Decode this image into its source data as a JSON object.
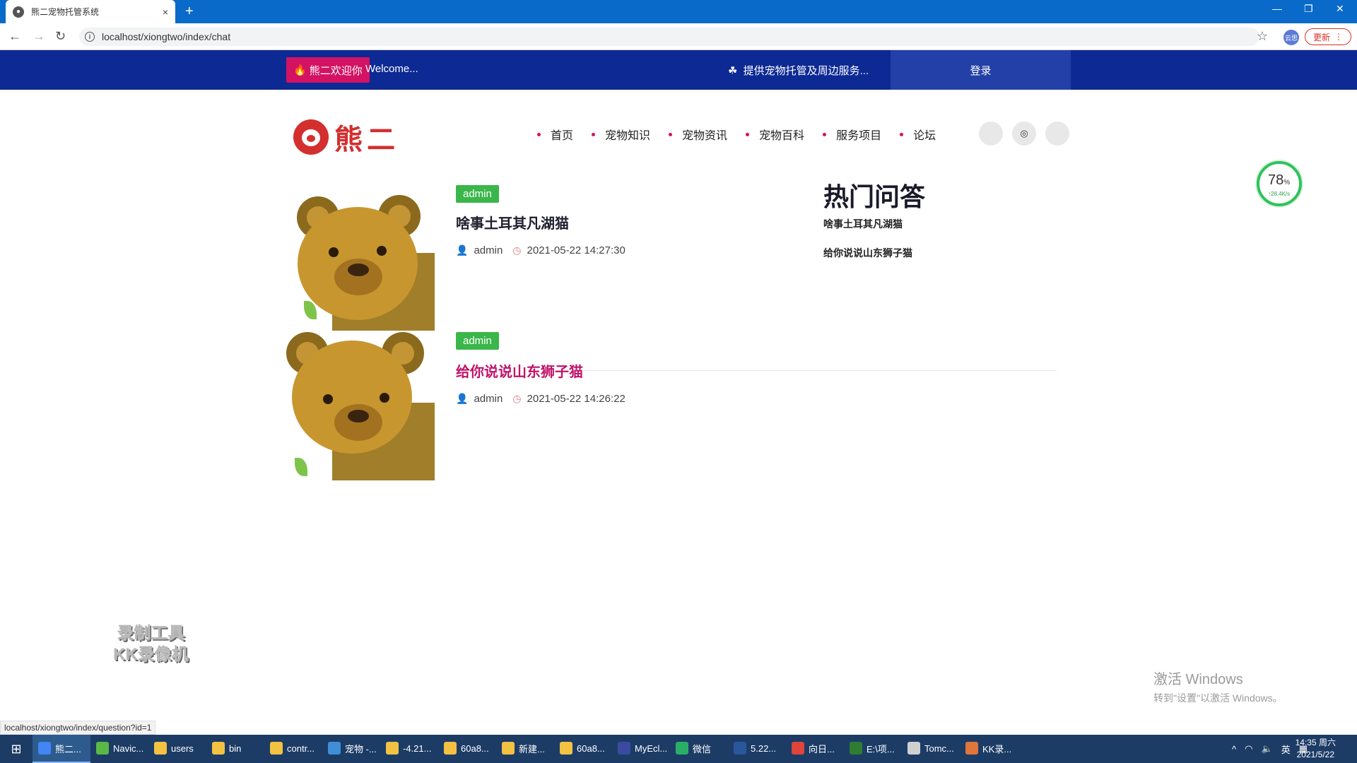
{
  "browser": {
    "tab_title": "熊二宠物托管系统",
    "tab_close": "×",
    "new_tab": "+",
    "url": "localhost/xiongtwo/index/chat",
    "profile": "云思",
    "update_label": "更新",
    "status_url": "localhost/xiongtwo/index/question?id=1"
  },
  "topbar": {
    "welcome_badge": "熊二欢迎你",
    "welcome_text": "Welcome...",
    "service_text": "提供宠物托管及周边服务...",
    "login_label": "登录"
  },
  "logo": {
    "text": "熊二"
  },
  "nav": {
    "items": [
      "首页",
      "宠物知识",
      "宠物资讯",
      "宠物百科",
      "服务项目",
      "论坛"
    ]
  },
  "posts": [
    {
      "tag": "admin",
      "title": "啥事土耳其凡湖猫",
      "author": "admin",
      "time": "2021-05-22 14:27:30"
    },
    {
      "tag": "admin",
      "title": "给你说说山东狮子猫",
      "author": "admin",
      "time": "2021-05-22 14:26:22"
    }
  ],
  "sidebar": {
    "title": "热门问答",
    "links": [
      "啥事土耳其凡湖猫",
      "给你说说山东狮子猫"
    ]
  },
  "speed_widget": {
    "percent": "78",
    "unit": "%",
    "rate": "↑28.4K/s"
  },
  "watermark": {
    "line1": "录制工具",
    "line2": "KK录像机"
  },
  "activate": {
    "line1": "激活 Windows",
    "line2": "转到\"设置\"以激活 Windows。"
  },
  "taskbar": {
    "items": [
      {
        "label": "熊二...",
        "color": "#4285f4"
      },
      {
        "label": "Navic...",
        "color": "#5ab946"
      },
      {
        "label": "users",
        "color": "#f3c242"
      },
      {
        "label": "bin",
        "color": "#f3c242"
      },
      {
        "label": "contr...",
        "color": "#f3c242"
      },
      {
        "label": "宠物 -...",
        "color": "#3e8ed8"
      },
      {
        "label": "-4.21...",
        "color": "#f3c242"
      },
      {
        "label": "60a8...",
        "color": "#f3c242"
      },
      {
        "label": "新建...",
        "color": "#f3c242"
      },
      {
        "label": "60a8...",
        "color": "#f3c242"
      },
      {
        "label": "MyEcl...",
        "color": "#3b4aa0"
      },
      {
        "label": "微信",
        "color": "#2aae67"
      },
      {
        "label": "5.22...",
        "color": "#2b579a"
      },
      {
        "label": "向日...",
        "color": "#e0443b"
      },
      {
        "label": "E:\\项...",
        "color": "#2e7d32"
      },
      {
        "label": "Tomc...",
        "color": "#d0d0d0"
      },
      {
        "label": "KK录...",
        "color": "#e0763b"
      }
    ],
    "tray_lang": "英",
    "clock_time": "14:35 周六",
    "clock_date": "2021/5/22"
  }
}
